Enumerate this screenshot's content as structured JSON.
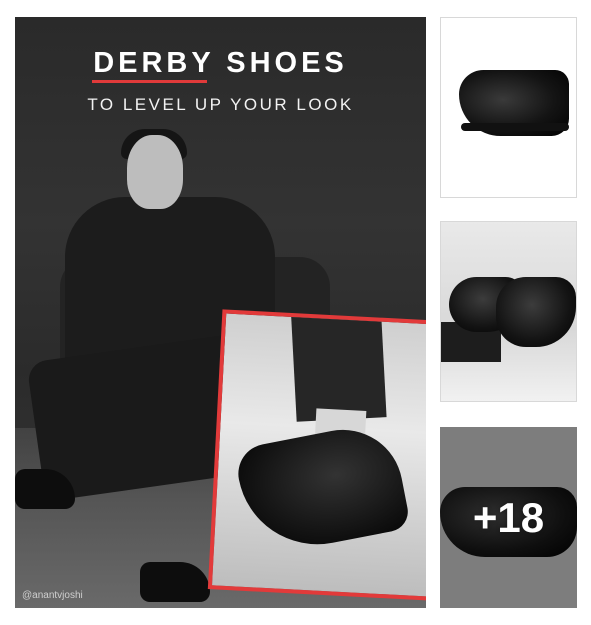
{
  "hero": {
    "headline": "DERBY SHOES",
    "subheadline": "TO LEVEL UP YOUR LOOK",
    "credit": "@anantvjoshi"
  },
  "thumbnails": {
    "more_count": "+18"
  },
  "colors": {
    "accent_red": "#e23a3a",
    "overlay_gray": "#7d7d7d"
  }
}
